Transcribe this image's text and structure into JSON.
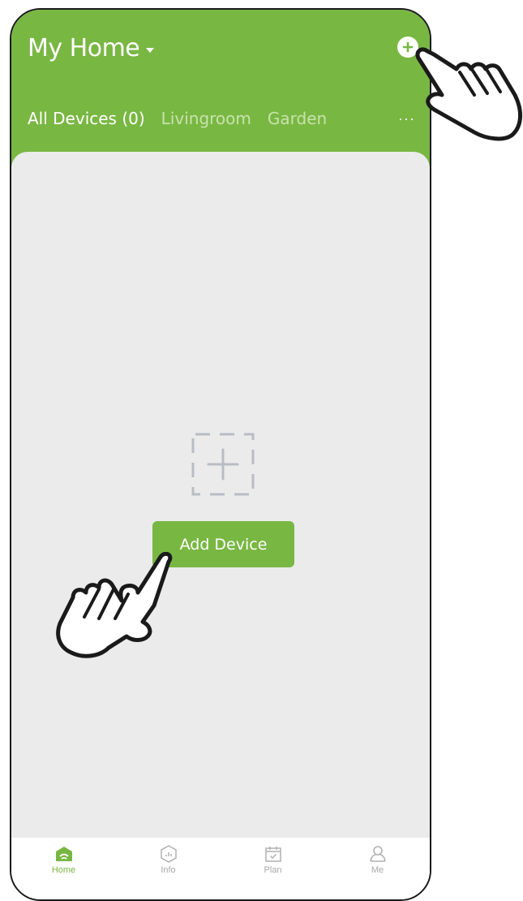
{
  "header": {
    "home_title": "My Home",
    "tabs": [
      {
        "label": "All Devices (0)",
        "active": true
      },
      {
        "label": "Livingroom",
        "active": false
      },
      {
        "label": "Garden",
        "active": false
      }
    ],
    "more_label": "···"
  },
  "empty_state": {
    "add_device_label": "Add Device"
  },
  "bottom_nav": {
    "items": [
      {
        "label": "Home",
        "icon": "home-icon",
        "active": true
      },
      {
        "label": "Info",
        "icon": "info-icon",
        "active": false
      },
      {
        "label": "Plan",
        "icon": "calendar-icon",
        "active": false
      },
      {
        "label": "Me",
        "icon": "user-icon",
        "active": false
      }
    ]
  },
  "colors": {
    "brand_green": "#79b743",
    "content_bg": "#ebebeb",
    "tab_inactive": "#c7e3ab",
    "nav_inactive": "#aaaaaa"
  }
}
